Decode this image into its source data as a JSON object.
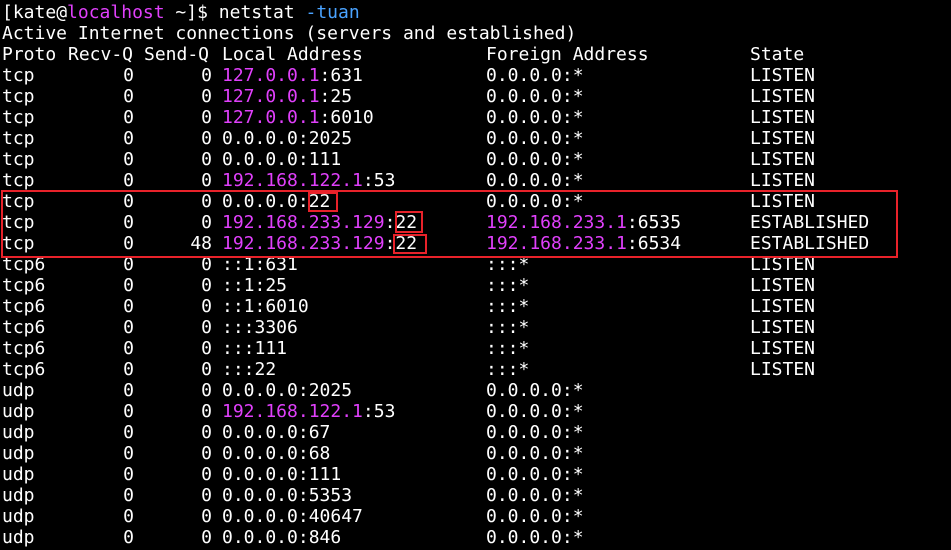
{
  "prompt": {
    "open": "[",
    "user": "kate",
    "at": "@",
    "host": "localhost",
    "path": " ~]$ ",
    "command": "netstat",
    "option": " -tuan"
  },
  "banner": "Active Internet connections (servers and established)",
  "headers": {
    "proto": "Proto",
    "recv": "Recv-Q",
    "send": "Send-Q",
    "local": "Local Address",
    "foreign": "Foreign Address",
    "state": "State"
  },
  "rows": [
    {
      "proto": "tcp",
      "recv": "0",
      "send": "0",
      "local_ip": "127.0.0.1",
      "local_port": ":631",
      "foreign_ip": "",
      "foreign_rest": "0.0.0.0:*",
      "state": "LISTEN"
    },
    {
      "proto": "tcp",
      "recv": "0",
      "send": "0",
      "local_ip": "127.0.0.1",
      "local_port": ":25",
      "foreign_ip": "",
      "foreign_rest": "0.0.0.0:*",
      "state": "LISTEN"
    },
    {
      "proto": "tcp",
      "recv": "0",
      "send": "0",
      "local_ip": "127.0.0.1",
      "local_port": ":6010",
      "foreign_ip": "",
      "foreign_rest": "0.0.0.0:*",
      "state": "LISTEN"
    },
    {
      "proto": "tcp",
      "recv": "0",
      "send": "0",
      "local_ip": "",
      "local_port": "0.0.0.0:2025",
      "foreign_ip": "",
      "foreign_rest": "0.0.0.0:*",
      "state": "LISTEN"
    },
    {
      "proto": "tcp",
      "recv": "0",
      "send": "0",
      "local_ip": "",
      "local_port": "0.0.0.0:111",
      "foreign_ip": "",
      "foreign_rest": "0.0.0.0:*",
      "state": "LISTEN"
    },
    {
      "proto": "tcp",
      "recv": "0",
      "send": "0",
      "local_ip": "192.168.122.1",
      "local_port": ":53",
      "foreign_ip": "",
      "foreign_rest": "0.0.0.0:*",
      "state": "LISTEN"
    },
    {
      "proto": "tcp",
      "recv": "0",
      "send": "0",
      "local_ip": "",
      "local_port": "0.0.0.0:22",
      "foreign_ip": "",
      "foreign_rest": "0.0.0.0:*",
      "state": "LISTEN"
    },
    {
      "proto": "tcp",
      "recv": "0",
      "send": "0",
      "local_ip": "192.168.233.129",
      "local_port": ":22",
      "foreign_ip": "192.168.233.1",
      "foreign_rest": ":6535",
      "state": "ESTABLISHED"
    },
    {
      "proto": "tcp",
      "recv": "0",
      "send": "48",
      "local_ip": "192.168.233.129",
      "local_port": ":22",
      "foreign_ip": "192.168.233.1",
      "foreign_rest": ":6534",
      "state": "ESTABLISHED"
    },
    {
      "proto": "tcp6",
      "recv": "0",
      "send": "0",
      "local_ip": "",
      "local_port": "::1:631",
      "foreign_ip": "",
      "foreign_rest": ":::*",
      "state": "LISTEN"
    },
    {
      "proto": "tcp6",
      "recv": "0",
      "send": "0",
      "local_ip": "",
      "local_port": "::1:25",
      "foreign_ip": "",
      "foreign_rest": ":::*",
      "state": "LISTEN"
    },
    {
      "proto": "tcp6",
      "recv": "0",
      "send": "0",
      "local_ip": "",
      "local_port": "::1:6010",
      "foreign_ip": "",
      "foreign_rest": ":::*",
      "state": "LISTEN"
    },
    {
      "proto": "tcp6",
      "recv": "0",
      "send": "0",
      "local_ip": "",
      "local_port": ":::3306",
      "foreign_ip": "",
      "foreign_rest": ":::*",
      "state": "LISTEN"
    },
    {
      "proto": "tcp6",
      "recv": "0",
      "send": "0",
      "local_ip": "",
      "local_port": ":::111",
      "foreign_ip": "",
      "foreign_rest": ":::*",
      "state": "LISTEN"
    },
    {
      "proto": "tcp6",
      "recv": "0",
      "send": "0",
      "local_ip": "",
      "local_port": ":::22",
      "foreign_ip": "",
      "foreign_rest": ":::*",
      "state": "LISTEN"
    },
    {
      "proto": "udp",
      "recv": "0",
      "send": "0",
      "local_ip": "",
      "local_port": "0.0.0.0:2025",
      "foreign_ip": "",
      "foreign_rest": "0.0.0.0:*",
      "state": ""
    },
    {
      "proto": "udp",
      "recv": "0",
      "send": "0",
      "local_ip": "192.168.122.1",
      "local_port": ":53",
      "foreign_ip": "",
      "foreign_rest": "0.0.0.0:*",
      "state": ""
    },
    {
      "proto": "udp",
      "recv": "0",
      "send": "0",
      "local_ip": "",
      "local_port": "0.0.0.0:67",
      "foreign_ip": "",
      "foreign_rest": "0.0.0.0:*",
      "state": ""
    },
    {
      "proto": "udp",
      "recv": "0",
      "send": "0",
      "local_ip": "",
      "local_port": "0.0.0.0:68",
      "foreign_ip": "",
      "foreign_rest": "0.0.0.0:*",
      "state": ""
    },
    {
      "proto": "udp",
      "recv": "0",
      "send": "0",
      "local_ip": "",
      "local_port": "0.0.0.0:111",
      "foreign_ip": "",
      "foreign_rest": "0.0.0.0:*",
      "state": ""
    },
    {
      "proto": "udp",
      "recv": "0",
      "send": "0",
      "local_ip": "",
      "local_port": "0.0.0.0:5353",
      "foreign_ip": "",
      "foreign_rest": "0.0.0.0:*",
      "state": ""
    },
    {
      "proto": "udp",
      "recv": "0",
      "send": "0",
      "local_ip": "",
      "local_port": "0.0.0.0:40647",
      "foreign_ip": "",
      "foreign_rest": "0.0.0.0:*",
      "state": ""
    },
    {
      "proto": "udp",
      "recv": "0",
      "send": "0",
      "local_ip": "",
      "local_port": "0.0.0.0:846",
      "foreign_ip": "",
      "foreign_rest": "0.0.0.0:*",
      "state": ""
    }
  ],
  "colors": {
    "background": "#000000",
    "text": "#ffffff",
    "ip_highlight": "#e040fb",
    "option": "#4aa3ff",
    "annotation_box": "#e8222a"
  }
}
